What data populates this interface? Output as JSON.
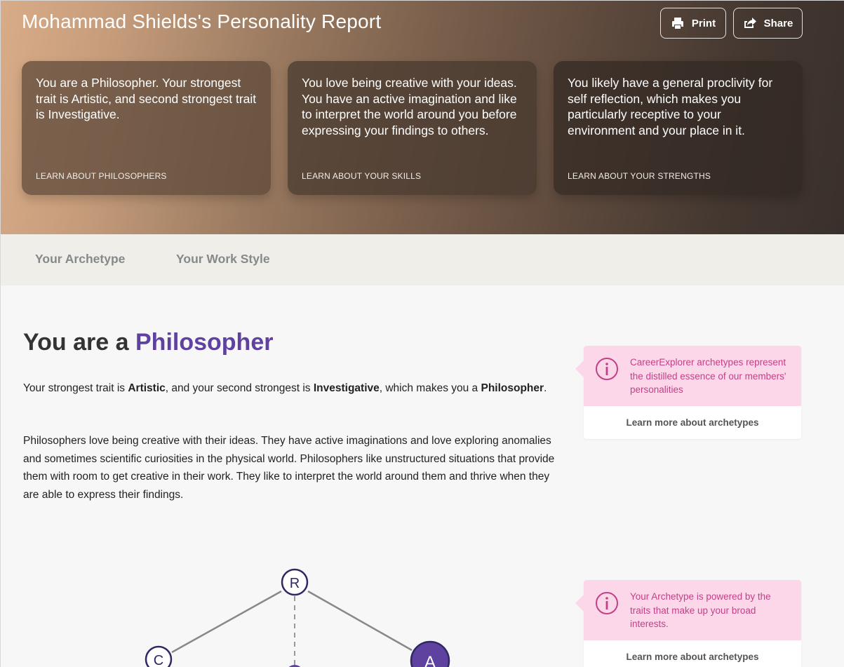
{
  "header": {
    "title": "Mohammad Shields's Personality Report",
    "print_label": "Print",
    "share_label": "Share"
  },
  "cards": [
    {
      "text": "You are a Philosopher. Your strongest trait is Artistic, and second strongest trait is Investigative.",
      "link": "LEARN ABOUT PHILOSOPHERS"
    },
    {
      "text": "You love being creative with your ideas. You have an active imagination and like to interpret the world around you before expressing your findings to others.",
      "link": "LEARN ABOUT YOUR SKILLS"
    },
    {
      "text": "You likely have a general proclivity for self reflection, which makes you particularly receptive to your environment and your place in it.",
      "link": "LEARN ABOUT YOUR STRENGTHS"
    }
  ],
  "tabs": [
    {
      "label": "Your Archetype"
    },
    {
      "label": "Your Work Style"
    }
  ],
  "main": {
    "heading_prefix": "You are a",
    "heading_accent": "Philosopher",
    "para1": {
      "t1": "Your strongest trait is ",
      "b1": "Artistic",
      "t2": ", and your second strongest is ",
      "b2": "Investigative",
      "t3": ", which makes you a ",
      "b3": "Philosopher",
      "t4": "."
    },
    "para2": "Philosophers love being creative with their ideas. They have active imaginations and love exploring anomalies and sometimes scientific curiosities in the physical world. Philosophers like unstructured situations that provide them with room to get creative in their work. They like to interpret the world around them and thrive when they are able to express their findings."
  },
  "info_boxes": [
    {
      "text": "CareerExplorer archetypes represent the distilled essence of our members' personalities",
      "link": "Learn more about archetypes"
    },
    {
      "text": "Your Archetype is powered by the traits that make up your broad interests.",
      "link": "Learn more about archetypes"
    }
  ],
  "diagram": {
    "nodes": {
      "r": "R",
      "c": "C",
      "a": "A"
    }
  },
  "colors": {
    "accent": "#5f42a0",
    "info_bg": "#fcd7ea",
    "info_text": "#c33f86",
    "tab_bg": "#efeee8"
  }
}
